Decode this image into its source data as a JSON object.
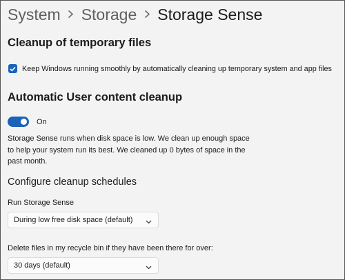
{
  "breadcrumb": {
    "items": [
      "System",
      "Storage"
    ],
    "current": "Storage Sense"
  },
  "cleanup_temp": {
    "title": "Cleanup of temporary files",
    "checkbox_label": "Keep Windows running smoothly by automatically cleaning up temporary system and app files",
    "checked": true
  },
  "auto_cleanup": {
    "title": "Automatic User content cleanup",
    "toggle_label": "On",
    "toggle_on": true,
    "description_lines": [
      "Storage Sense runs when disk space is low. We clean up enough space",
      "to help your system run its best. We cleaned up 0 bytes of space in the",
      "past month."
    ]
  },
  "schedules": {
    "title": "Configure cleanup schedules",
    "run_label": "Run Storage Sense",
    "run_value": "During low free disk space (default)",
    "recycle_label": "Delete files in my recycle bin if they have been there for over:",
    "recycle_value": "30 days (default)"
  },
  "colors": {
    "accent": "#1a63b8",
    "background": "#f3f3f3",
    "text": "#1b1b1b"
  }
}
